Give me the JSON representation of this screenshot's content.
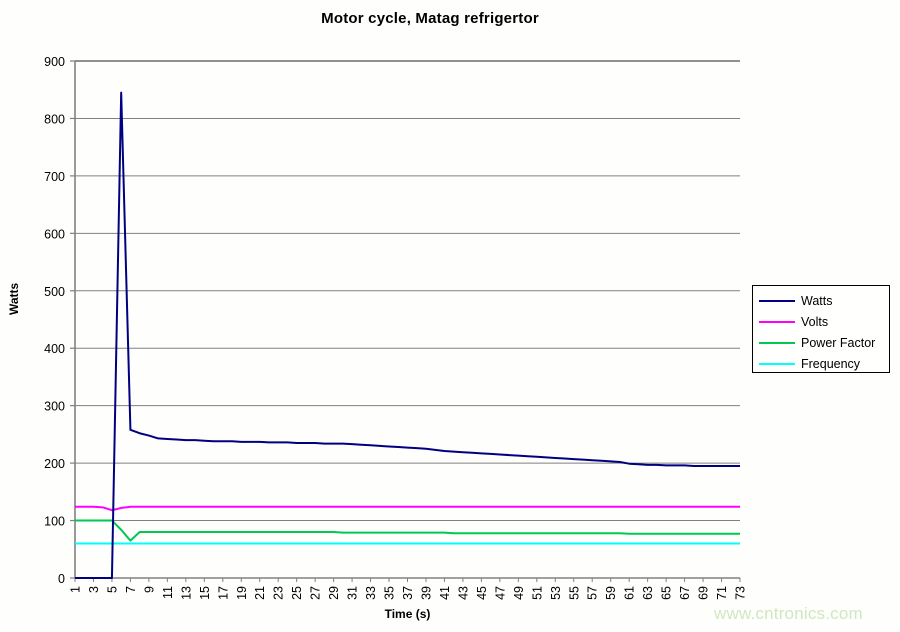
{
  "chart_data": {
    "type": "line",
    "title": "Motor cycle, Matag refrigertor",
    "xlabel": "Time (s)",
    "ylabel": "Watts",
    "xlim": [
      1,
      73
    ],
    "ylim": [
      0,
      900
    ],
    "ytick_step": 100,
    "yticks": [
      0,
      100,
      200,
      300,
      400,
      500,
      600,
      700,
      800,
      900
    ],
    "xticks": [
      1,
      3,
      5,
      7,
      9,
      11,
      13,
      15,
      17,
      19,
      21,
      23,
      25,
      27,
      29,
      31,
      33,
      35,
      37,
      39,
      41,
      43,
      45,
      47,
      49,
      51,
      53,
      55,
      57,
      59,
      61,
      63,
      65,
      67,
      69,
      71,
      73
    ],
    "x": [
      1,
      2,
      3,
      4,
      5,
      6,
      7,
      8,
      9,
      10,
      11,
      12,
      13,
      14,
      15,
      16,
      17,
      18,
      19,
      20,
      21,
      22,
      23,
      24,
      25,
      26,
      27,
      28,
      29,
      30,
      31,
      32,
      33,
      34,
      35,
      36,
      37,
      38,
      39,
      40,
      41,
      42,
      43,
      44,
      45,
      46,
      47,
      48,
      49,
      50,
      51,
      52,
      53,
      54,
      55,
      56,
      57,
      58,
      59,
      60,
      61,
      62,
      63,
      64,
      65,
      66,
      67,
      68,
      69,
      70,
      71,
      72,
      73
    ],
    "grid": "horizontal",
    "legend_position": "right",
    "series": [
      {
        "name": "Watts",
        "color": "#000080",
        "values": [
          0,
          0,
          0,
          0,
          0,
          845,
          258,
          252,
          248,
          243,
          242,
          241,
          240,
          240,
          239,
          238,
          238,
          238,
          237,
          237,
          237,
          236,
          236,
          236,
          235,
          235,
          235,
          234,
          234,
          234,
          233,
          232,
          231,
          230,
          229,
          228,
          227,
          226,
          225,
          223,
          221,
          220,
          219,
          218,
          217,
          216,
          215,
          214,
          213,
          212,
          211,
          210,
          209,
          208,
          207,
          206,
          205,
          204,
          203,
          202,
          199,
          198,
          197,
          197,
          196,
          196,
          196,
          195,
          195,
          195,
          195,
          195,
          195
        ]
      },
      {
        "name": "Volts",
        "color": "#FF00FF",
        "values": [
          124,
          124,
          124,
          123,
          118,
          122,
          124,
          124,
          124,
          124,
          124,
          124,
          124,
          124,
          124,
          124,
          124,
          124,
          124,
          124,
          124,
          124,
          124,
          124,
          124,
          124,
          124,
          124,
          124,
          124,
          124,
          124,
          124,
          124,
          124,
          124,
          124,
          124,
          124,
          124,
          124,
          124,
          124,
          124,
          124,
          124,
          124,
          124,
          124,
          124,
          124,
          124,
          124,
          124,
          124,
          124,
          124,
          124,
          124,
          124,
          124,
          124,
          124,
          124,
          124,
          124,
          124,
          124,
          124,
          124,
          124,
          124,
          124
        ]
      },
      {
        "name": "Power Factor",
        "color": "#00C853",
        "values": [
          100,
          100,
          100,
          100,
          100,
          84,
          65,
          80,
          80,
          80,
          80,
          80,
          80,
          80,
          80,
          80,
          80,
          80,
          80,
          80,
          80,
          80,
          80,
          80,
          80,
          80,
          80,
          80,
          80,
          79,
          79,
          79,
          79,
          79,
          79,
          79,
          79,
          79,
          79,
          79,
          79,
          78,
          78,
          78,
          78,
          78,
          78,
          78,
          78,
          78,
          78,
          78,
          78,
          78,
          78,
          78,
          78,
          78,
          78,
          78,
          77,
          77,
          77,
          77,
          77,
          77,
          77,
          77,
          77,
          77,
          77,
          77,
          77
        ]
      },
      {
        "name": "Frequency",
        "color": "#00FFFF",
        "values": [
          60,
          60,
          60,
          60,
          60,
          60,
          60,
          60,
          60,
          60,
          60,
          60,
          60,
          60,
          60,
          60,
          60,
          60,
          60,
          60,
          60,
          60,
          60,
          60,
          60,
          60,
          60,
          60,
          60,
          60,
          60,
          60,
          60,
          60,
          60,
          60,
          60,
          60,
          60,
          60,
          60,
          60,
          60,
          60,
          60,
          60,
          60,
          60,
          60,
          60,
          60,
          60,
          60,
          60,
          60,
          60,
          60,
          60,
          60,
          60,
          60,
          60,
          60,
          60,
          60,
          60,
          60,
          60,
          60,
          60,
          60,
          60,
          60
        ]
      }
    ]
  },
  "legend": {
    "items": [
      {
        "label": "Watts",
        "color": "#000080"
      },
      {
        "label": "Volts",
        "color": "#FF00FF"
      },
      {
        "label": "Power Factor",
        "color": "#00C853"
      },
      {
        "label": "Frequency",
        "color": "#00FFFF"
      }
    ]
  },
  "watermark": {
    "text": "www.cntronics.com"
  },
  "colors": {
    "axis": "#808080",
    "grid": "#808080",
    "background": "#FEFEFC",
    "text": "#000000"
  }
}
